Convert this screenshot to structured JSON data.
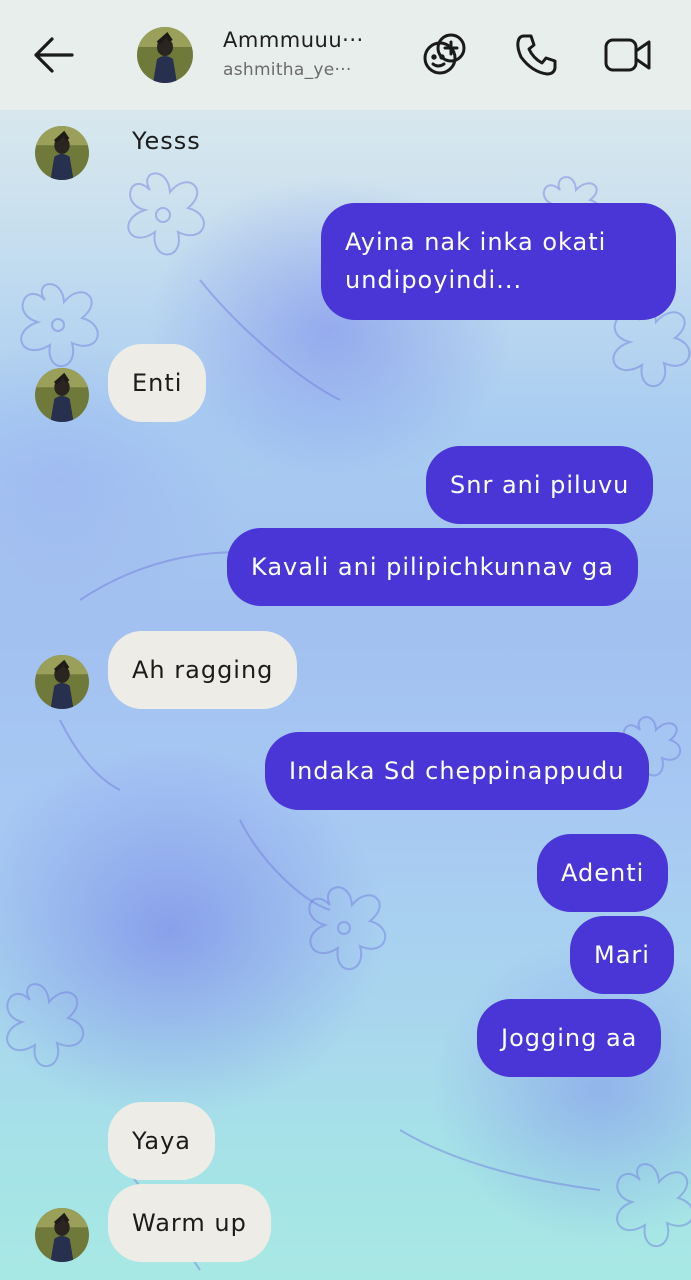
{
  "header": {
    "title": "Ammmuuu···",
    "subtitle": "ashmitha_ye···",
    "icons": [
      "back-arrow-icon",
      "sticker-add-icon",
      "phone-icon",
      "video-camera-icon"
    ]
  },
  "messages": [
    {
      "side": "incoming",
      "text": "Yesss"
    },
    {
      "side": "outgoing",
      "text": "Ayina nak inka okati undipoyindi..."
    },
    {
      "side": "incoming",
      "text": "Enti"
    },
    {
      "side": "outgoing",
      "text": "Snr ani piluvu"
    },
    {
      "side": "outgoing",
      "text": "Kavali ani pilipichkunnav ga"
    },
    {
      "side": "incoming",
      "text": "Ah ragging"
    },
    {
      "side": "outgoing",
      "text": "Indaka Sd cheppinappudu"
    },
    {
      "side": "outgoing",
      "text": "Adenti"
    },
    {
      "side": "outgoing",
      "text": "Mari"
    },
    {
      "side": "outgoing",
      "text": "Jogging aa"
    },
    {
      "side": "incoming",
      "text": "Yaya"
    },
    {
      "side": "incoming",
      "text": "Warm up"
    }
  ],
  "colors": {
    "outgoing_bubble": "#4a35d6",
    "incoming_bubble": "#eeece6",
    "header_bg": "#e8eeeb"
  }
}
